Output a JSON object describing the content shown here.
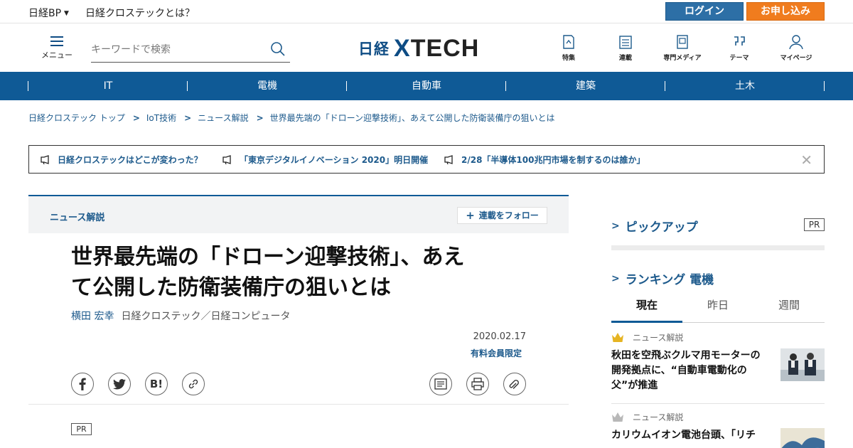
{
  "topbar": {
    "brand": "日経BP",
    "about": "日経クロステックとは？",
    "login": "ログイン",
    "apply": "お申し込み"
  },
  "header": {
    "menu_label": "メニュー",
    "search_placeholder": "キーワードで検索",
    "logo_nikkei": "日経",
    "logo_xtech_x": "X",
    "logo_xtech_rest": "TECH",
    "nav": [
      "特集",
      "連載",
      "専門メディア",
      "テーマ",
      "マイページ"
    ]
  },
  "category_nav": [
    "IT",
    "電機",
    "自動車",
    "建築",
    "土木"
  ],
  "breadcrumb": [
    "日経クロステック トップ",
    "IoT技術",
    "ニュース解説",
    "世界最先端の「ドローン迎撃技術」、あえて公開した防衛装備庁の狙いとは"
  ],
  "notices": [
    "日経クロステックはどこが変わった？",
    "「東京デジタルイノベーション 2020」明日開催",
    "2/28「半導体100兆円市場を制するのは誰か」"
  ],
  "article": {
    "series": "ニュース解説",
    "follow": "連載をフォロー",
    "title_line1": "世界最先端の「ドローン迎撃技術」、あえ",
    "title_line2": "て公開した防衛装備庁の狙いとは",
    "author": "横田 宏幸",
    "media": "日経クロステック／日経コンピュータ",
    "date": "2020.02.17",
    "paid": "有料会員限定",
    "share_buttons": [
      "facebook-icon",
      "twitter-icon",
      "hatena-icon",
      "link-icon"
    ],
    "tool_buttons": [
      "comment-icon",
      "print-icon",
      "clip-icon"
    ],
    "hatena_text": "B!",
    "pr": "PR"
  },
  "sidebar": {
    "pickup_title": "ピックアップ",
    "pickup_pr": "PR",
    "ranking_title": "ランキング 電機",
    "tabs": [
      "現在",
      "昨日",
      "週間"
    ],
    "ranking": [
      {
        "category": "ニュース解説",
        "title": "秋田を空飛ぶクルマ用モーターの開発拠点に、“自動車電動化の父”が推進"
      },
      {
        "category": "ニュース解説",
        "title": "カリウムイオン電池台頭、「リチ"
      }
    ]
  },
  "colors": {
    "brand_blue": "#0f5a96",
    "link_blue": "#1d5a8c",
    "login_bg": "#2d6fa6",
    "apply_bg": "#f07c1e",
    "crown_gold": "#e6b422",
    "crown_silver": "#b8b8b8"
  }
}
